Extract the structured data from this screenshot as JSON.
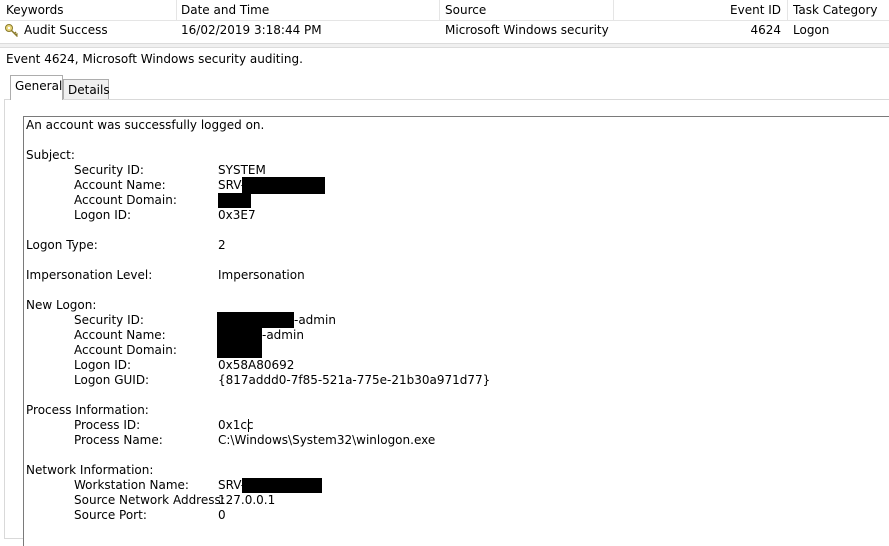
{
  "grid": {
    "headers": {
      "keywords": "Keywords",
      "date_time": "Date and Time",
      "source": "Source",
      "event_id": "Event ID",
      "task_category": "Task Category"
    },
    "row": {
      "keywords": "Audit Success",
      "date_time": "16/02/2019 3:18:44 PM",
      "source": "Microsoft Windows security ...",
      "event_id": "4624",
      "task_category": "Logon"
    }
  },
  "details": {
    "title": "Event 4624, Microsoft Windows security auditing.",
    "tabs": [
      "General",
      "Details"
    ],
    "active_tab": "General",
    "message": "An account was successfully logged on.",
    "subject": {
      "header": "Subject:",
      "security_id_label": "Security ID:",
      "security_id": "SYSTEM",
      "account_name_label": "Account Name:",
      "account_name": "SRV-",
      "account_domain_label": "Account Domain:",
      "logon_id_label": "Logon ID:",
      "logon_id": "0x3E7"
    },
    "logon_type_label": "Logon Type:",
    "logon_type": "2",
    "impersonation_label": "Impersonation Level:",
    "impersonation": "Impersonation",
    "new_logon": {
      "header": "New Logon:",
      "security_id_label": "Security ID:",
      "security_id_suffix": "-admin",
      "account_name_label": "Account Name:",
      "account_name_suffix": "-admin",
      "account_domain_label": "Account Domain:",
      "logon_id_label": "Logon ID:",
      "logon_id": "0x58A80692",
      "logon_guid_label": "Logon GUID:",
      "logon_guid": "{817addd0-7f85-521a-775e-21b30a971d77}"
    },
    "process": {
      "header": "Process Information:",
      "process_id_label": "Process ID:",
      "process_id": "0x1cc",
      "process_name_label": "Process Name:",
      "process_name": "C:\\Windows\\System32\\winlogon.exe"
    },
    "network": {
      "header": "Network Information:",
      "workstation_label": "Workstation Name:",
      "workstation": "SRV-",
      "source_address_label": "Source Network Address:",
      "source_address": "127.0.0.1",
      "source_port_label": "Source Port:",
      "source_port": "0"
    }
  },
  "icons": {
    "audit_success": "key-icon"
  },
  "colors": {
    "redaction": "#000000",
    "border": "#adadad"
  }
}
